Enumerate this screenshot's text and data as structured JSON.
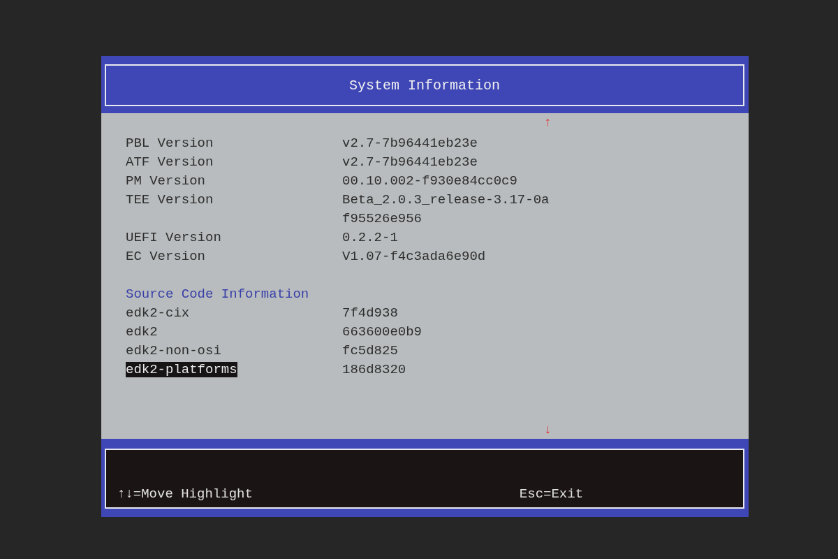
{
  "title": "System Information",
  "scroll_up": "↑",
  "scroll_down": "↓",
  "rows": [
    {
      "kind": "info",
      "label": "PBL Version",
      "value": [
        "v2.7-7b96441eb23e"
      ]
    },
    {
      "kind": "info",
      "label": "ATF Version",
      "value": [
        "v2.7-7b96441eb23e"
      ]
    },
    {
      "kind": "info",
      "label": "PM Version",
      "value": [
        "00.10.002-f930e84cc0c9"
      ]
    },
    {
      "kind": "info",
      "label": "TEE Version",
      "value": [
        "Beta_2.0.3_release-3.17-0a",
        "f95526e956"
      ]
    },
    {
      "kind": "info",
      "label": "UEFI Version",
      "value": [
        "0.2.2-1"
      ]
    },
    {
      "kind": "info",
      "label": "EC Version",
      "value": [
        "V1.07-f4c3ada6e90d"
      ]
    },
    {
      "kind": "blank"
    },
    {
      "kind": "heading",
      "label": "Source Code Information"
    },
    {
      "kind": "item",
      "label": "edk2-cix",
      "value": [
        "7f4d938"
      ],
      "selected": false
    },
    {
      "kind": "item",
      "label": "edk2",
      "value": [
        "663600e0b9"
      ],
      "selected": false
    },
    {
      "kind": "item",
      "label": "edk2-non-osi",
      "value": [
        "fc5d825"
      ],
      "selected": false
    },
    {
      "kind": "item",
      "label": "edk2-platforms",
      "value": [
        "186d8320"
      ],
      "selected": true
    }
  ],
  "footer": {
    "left": "↑↓=Move Highlight",
    "right": "Esc=Exit"
  }
}
